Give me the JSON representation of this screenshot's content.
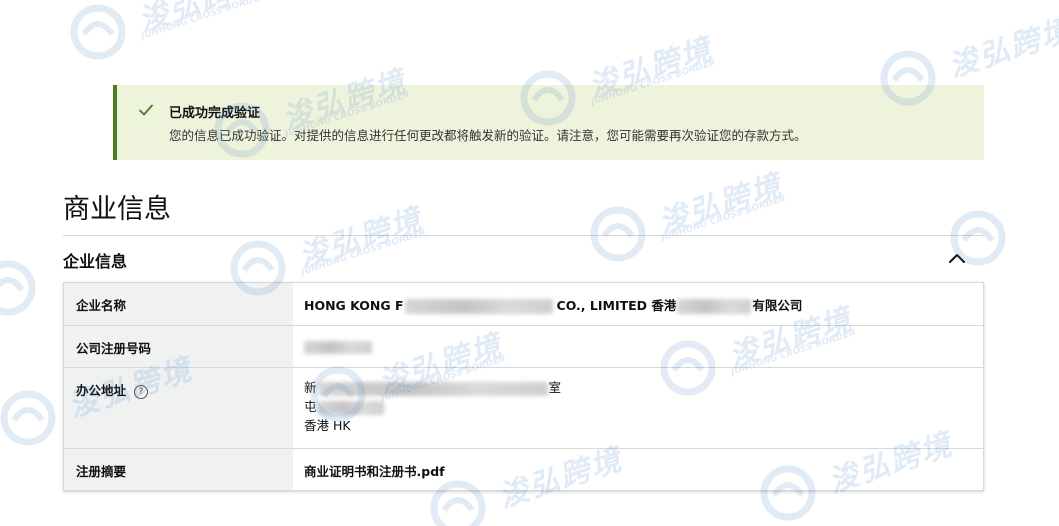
{
  "alert": {
    "title": "已成功完成验证",
    "message": "您的信息已成功验证。对提供的信息进行任何更改都将触发新的验证。请注意，您可能需要再次验证您的存款方式。",
    "icon": "check-icon",
    "accent_color": "#4e7c24",
    "background_color": "#eef3dc"
  },
  "section": {
    "title": "商业信息"
  },
  "subsection": {
    "title": "企业信息",
    "toggle_icon": "chevron-up-icon"
  },
  "table": {
    "rows": [
      {
        "label": "企业名称",
        "value_start": "HONG KONG F",
        "value_mid": "CO., LIMITED 香港",
        "value_end": "有限公司"
      },
      {
        "label": "公司注册号码"
      },
      {
        "label": "办公地址",
        "help_icon": "question-circle-icon",
        "help_glyph": "?",
        "lines": [
          "新",
          "屯",
          "香港 HK"
        ],
        "line1_end": "室"
      },
      {
        "label": "注册摘要",
        "value": "商业证明书和注册书.pdf"
      }
    ]
  },
  "watermark": {
    "text": "浚弘跨境",
    "subtext": "JUNHONG CROSS BORDER"
  }
}
